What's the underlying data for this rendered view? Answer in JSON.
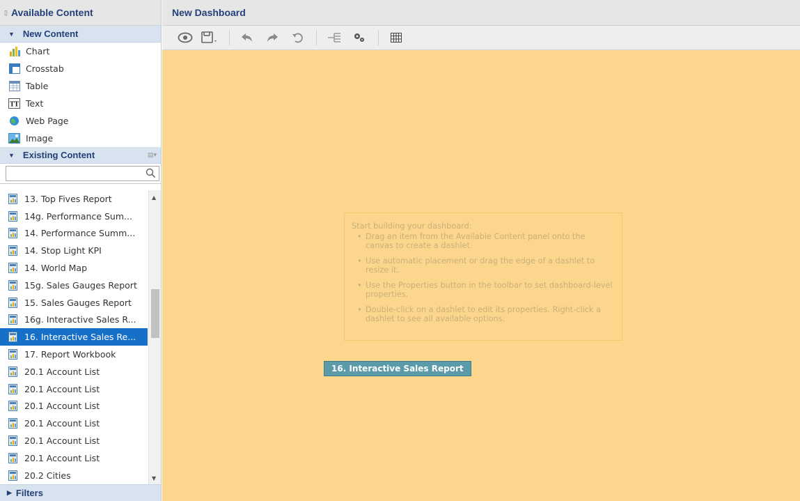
{
  "left_panel": {
    "title": "Available Content",
    "new_content": {
      "header": "New Content",
      "items": [
        {
          "label": "Chart",
          "icon": "chart-icon"
        },
        {
          "label": "Crosstab",
          "icon": "crosstab-icon"
        },
        {
          "label": "Table",
          "icon": "table-icon"
        },
        {
          "label": "Text",
          "icon": "text-icon"
        },
        {
          "label": "Web Page",
          "icon": "globe-icon"
        },
        {
          "label": "Image",
          "icon": "image-icon"
        }
      ]
    },
    "existing_content": {
      "header": "Existing Content",
      "search_value": "",
      "items": [
        "13. Top Fives Report",
        "14g. Performance Sum...",
        "14. Performance Summ...",
        "14. Stop Light KPI",
        "14. World Map",
        "15g. Sales Gauges Report",
        "15. Sales Gauges Report",
        "16g. Interactive Sales R...",
        "16. Interactive Sales Re...",
        "17. Report Workbook",
        "20.1 Account List",
        "20.1 Account List",
        "20.1 Account List",
        "20.1 Account List",
        "20.1 Account List",
        "20.1 Account List",
        "20.2 Cities"
      ],
      "selected_index": 8
    },
    "filters_label": "Filters"
  },
  "main": {
    "title": "New Dashboard",
    "toolbar": [
      "preview-icon",
      "save-icon",
      "undo-icon",
      "redo-icon",
      "undo-all-icon",
      "properties-icon",
      "settings-icon",
      "grid-icon"
    ],
    "hint": {
      "title": "Start building your dashboard:",
      "items": [
        "Drag an item from the Available Content panel onto the canvas to create a dashlet.",
        "Use automatic placement or drag the edge of a dashlet to resize it.",
        "Use the Properties button in the toolbar to set dashboard-level properties.",
        "Double-click on a dashlet to edit its properties. Right-click a dashlet to see all available options."
      ]
    },
    "drag_label": "16. Interactive Sales Report"
  },
  "colors": {
    "canvas": "#fcd68c",
    "selection": "#1670c8",
    "header_text": "#23407a",
    "drag_label": "#5b9aa8"
  }
}
